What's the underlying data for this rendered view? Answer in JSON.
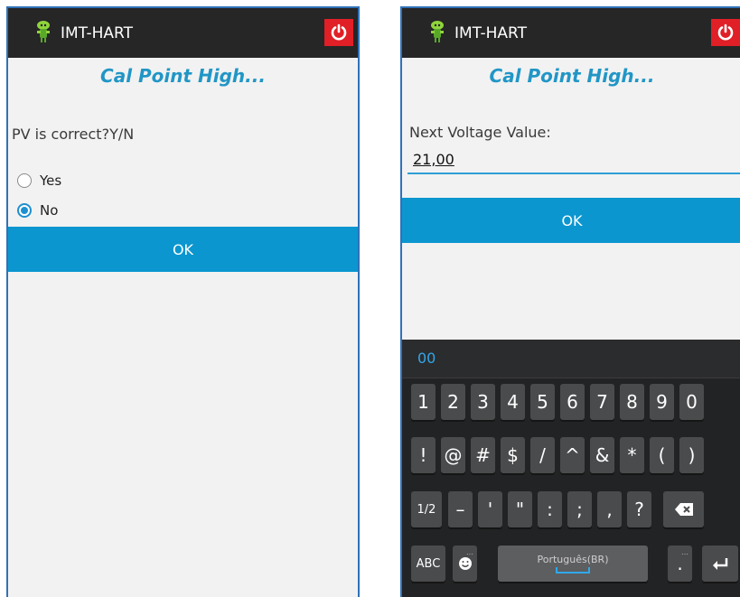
{
  "colors": {
    "appbar": "#262626",
    "power_button": "#e01f26",
    "accent": "#0b96cf",
    "subtitle": "#2196c6",
    "keyboard": "#222325",
    "suggestion": "#34a6e8"
  },
  "left": {
    "app_title": "IMT-HART",
    "subtitle": "Cal Point High...",
    "prompt": "PV is correct?Y/N",
    "options": [
      {
        "label": "Yes",
        "checked": false
      },
      {
        "label": "No",
        "checked": true
      }
    ],
    "ok_label": "OK"
  },
  "right": {
    "app_title": "IMT-HART",
    "subtitle": "Cal Point High...",
    "field_label": "Next Voltage Value:",
    "field_value": "21,00",
    "ok_label": "OK",
    "keyboard": {
      "suggestion": "00",
      "row1": [
        "1",
        "2",
        "3",
        "4",
        "5",
        "6",
        "7",
        "8",
        "9",
        "0"
      ],
      "row2": [
        "!",
        "@",
        "#",
        "$",
        "/",
        "^",
        "&",
        "*",
        "(",
        ")"
      ],
      "row3": [
        "1/2",
        "–",
        "'",
        "\"",
        ":",
        ";",
        ",",
        "?"
      ],
      "row3_icons": [
        "backspace-icon"
      ],
      "row4": {
        "abc": "ABC",
        "emoji_icon": "smiley-icon",
        "space_label": "Português(BR)",
        "period": ".",
        "enter_icon": "enter-icon"
      }
    }
  }
}
